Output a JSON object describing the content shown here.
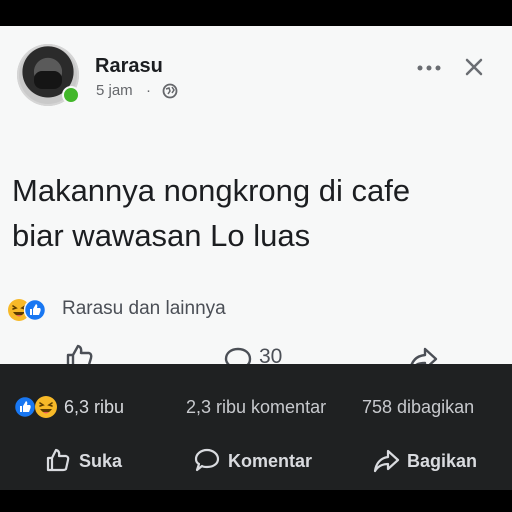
{
  "post": {
    "author": "Rarasu",
    "time": "5 jam",
    "separator": "·",
    "text_lines": [
      "Makannya nongkrong di cafe",
      "biar wawasan Lo luas"
    ],
    "reaction_text": "Rarasu dan lainnya",
    "comment_count": "30",
    "icons": {
      "more": "more-horizontal-icon",
      "close": "close-icon",
      "privacy": "globe-icon",
      "reactions": [
        "haha-icon",
        "like-icon"
      ],
      "actions": [
        "like-icon",
        "comment-icon",
        "share-icon"
      ]
    },
    "colors": {
      "text": "#1c1e21",
      "secondary": "#65676b",
      "online": "#42b72a",
      "like_blue": "#1877f2",
      "haha_yellow": "#f7b928"
    }
  },
  "footer": {
    "reaction_count": "6,3 ribu",
    "comments": "2,3 ribu komentar",
    "shares": "758 dibagikan",
    "actions": {
      "like": "Suka",
      "comment": "Komentar",
      "share": "Bagikan"
    },
    "colors": {
      "background": "#1f2122",
      "text": "#d7d9dd"
    }
  }
}
